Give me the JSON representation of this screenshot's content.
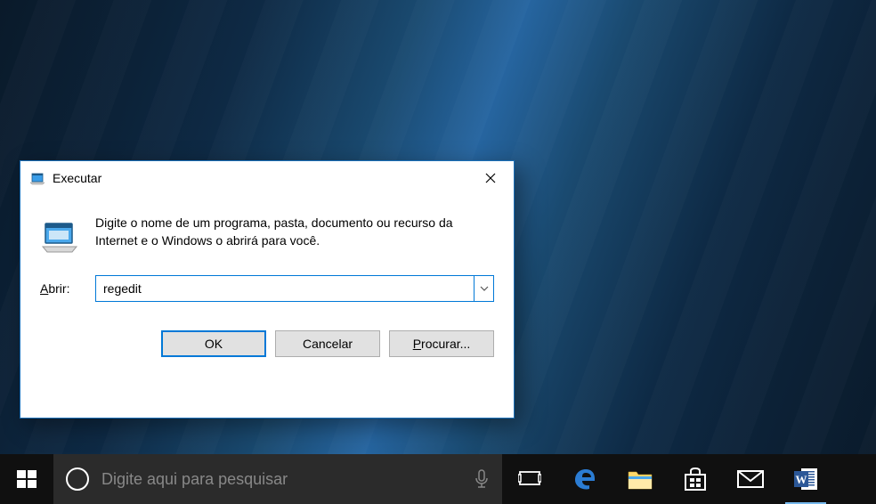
{
  "dialog": {
    "title": "Executar",
    "description": "Digite o nome de um programa, pasta, documento ou recurso da Internet e o Windows o abrirá para você.",
    "input_label_prefix": "A",
    "input_label_rest": "brir:",
    "input_value": "regedit",
    "buttons": {
      "ok": "OK",
      "cancel": "Cancelar",
      "browse_prefix": "P",
      "browse_rest": "rocurar..."
    }
  },
  "taskbar": {
    "search_placeholder": "Digite aqui para pesquisar"
  },
  "icons": {
    "run": "run-icon",
    "close": "close-icon",
    "start": "windows-logo",
    "cortana": "cortana-ring",
    "mic": "microphone-icon",
    "taskview": "task-view-icon",
    "edge": "edge-icon",
    "explorer": "file-explorer-icon",
    "store": "store-icon",
    "mail": "mail-icon",
    "word": "word-icon"
  }
}
